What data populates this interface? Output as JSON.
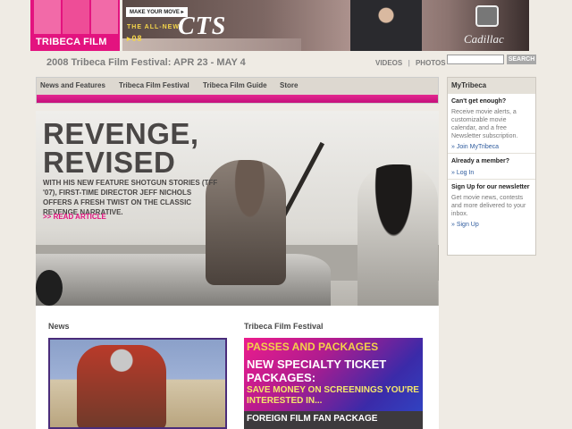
{
  "brand": {
    "logo_text": "TRIBECA FILM",
    "accent_color": "#e3137f"
  },
  "ad": {
    "tag": "MAKE YOUR MOVE ▸",
    "all_new": "THE ALL-NEW",
    "year": "▸08",
    "model": "CTS",
    "brand": "Cadillac"
  },
  "festival": {
    "line": "2008 Tribeca Film Festival: APR 23 - MAY 4"
  },
  "top_links": {
    "videos": "VIDEOS",
    "separator": "|",
    "photos": "PHOTOS"
  },
  "search": {
    "button": "SEARCH",
    "placeholder": ""
  },
  "nav": {
    "items": [
      {
        "label": "News and Features"
      },
      {
        "label": "Tribeca Film Festival"
      },
      {
        "label": "Tribeca Film Guide"
      },
      {
        "label": "Store"
      }
    ]
  },
  "feature": {
    "title_line1": "REVENGE,",
    "title_line2": "REVISED",
    "desc": "WITH HIS NEW FEATURE SHOTGUN STORIES (TFF '07), FIRST-TIME DIRECTOR JEFF NICHOLS OFFERS A FRESH TWIST ON THE CLASSIC REVENGE NARRATIVE.",
    "read_more": ">> READ ARTICLE"
  },
  "sections": {
    "news": "News",
    "festival": "Tribeca Film Festival"
  },
  "promo": {
    "title": "PASSES AND PACKAGES",
    "subtitle": "NEW SPECIALTY TICKET PACKAGES:",
    "body": "SAVE MONEY ON SCREENINGS YOU'RE INTERESTED IN...",
    "package": "FOREIGN FILM FAN PACKAGE"
  },
  "sidebar": {
    "title": "MyTribeca",
    "blocks": [
      {
        "heading": "Can't get enough?",
        "body": "Receive movie alerts, a customizable movie calendar, and a free Newsletter subscription.",
        "link": "» Join MyTribeca"
      },
      {
        "heading": "Already a member?",
        "body": "",
        "link": "» Log In"
      },
      {
        "heading": "Sign Up for our newsletter",
        "body": "Get movie news, contests and more delivered to your inbox.",
        "link": "» Sign Up"
      }
    ]
  }
}
